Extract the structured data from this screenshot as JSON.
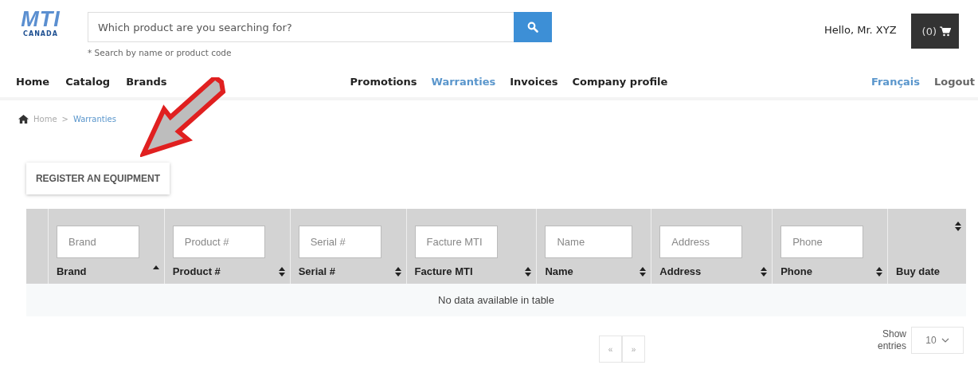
{
  "header": {
    "logo": {
      "name": "MTI",
      "subtitle": "CANADA"
    },
    "search": {
      "placeholder": "Which product are you searching for?",
      "hint": "* Search by name or product code"
    },
    "greeting": "Hello, Mr. XYZ",
    "cart": "(0)"
  },
  "nav": {
    "left": [
      {
        "label": "Home",
        "selected": false
      },
      {
        "label": "Catalog",
        "selected": false
      },
      {
        "label": "Brands",
        "selected": false
      }
    ],
    "center": [
      {
        "label": "Promotions",
        "selected": false
      },
      {
        "label": "Warranties",
        "selected": true
      },
      {
        "label": "Invoices",
        "selected": false
      },
      {
        "label": "Company profile",
        "selected": false
      }
    ],
    "right": [
      {
        "label": "Français",
        "kind": "language"
      },
      {
        "label": "Logout",
        "kind": "action"
      }
    ]
  },
  "breadcrumb": [
    {
      "label": "Home",
      "selected": false
    },
    {
      "label": "Warranties",
      "selected": true
    }
  ],
  "breadcrumb_separator": ">",
  "register_button": "REGISTER AN EQUIPMENT",
  "table": {
    "columns": [
      {
        "label": "Brand",
        "placeholder": "Brand",
        "sorted": true
      },
      {
        "label": "Product #",
        "placeholder": "Product #",
        "sorted": false
      },
      {
        "label": "Serial #",
        "placeholder": "Serial #",
        "sorted": false
      },
      {
        "label": "Facture MTI",
        "placeholder": "Facture MTI",
        "sorted": false
      },
      {
        "label": "Name",
        "placeholder": "Name",
        "sorted": false
      },
      {
        "label": "Address",
        "placeholder": "Address",
        "sorted": false
      },
      {
        "label": "Phone",
        "placeholder": "Phone",
        "sorted": false
      },
      {
        "label": "Buy date",
        "sorted": false
      }
    ],
    "empty_message": "No data available in table"
  },
  "pagination": {
    "prev": "«",
    "next": "»"
  },
  "page_size": {
    "label": "Show entries",
    "value": "10"
  }
}
